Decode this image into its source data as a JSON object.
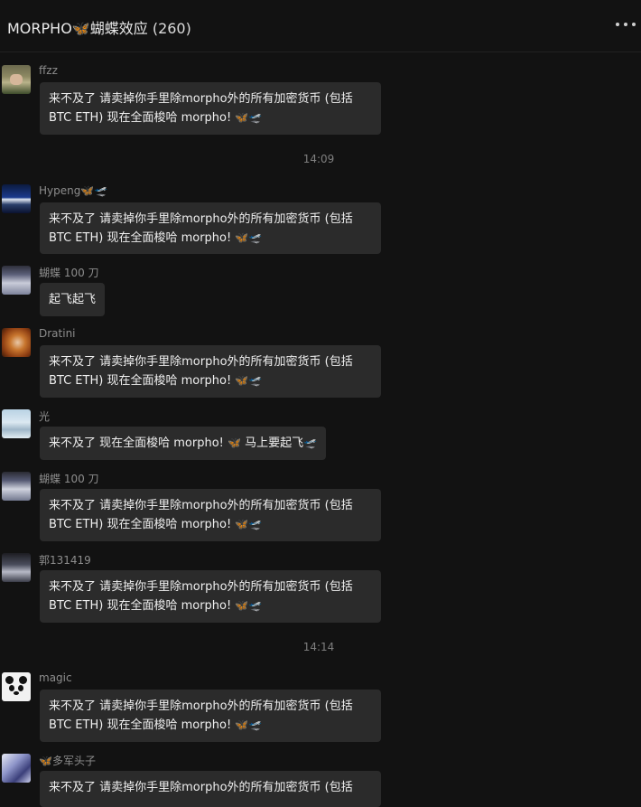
{
  "header": {
    "title_text": "MORPHO",
    "title_icon": "🦋",
    "title_suffix": "蝴蝶效应",
    "member_count": "(260)",
    "more_icon": "more-dots-icon"
  },
  "emoji": {
    "butterfly": "🦋",
    "plane": "🛫"
  },
  "messages": [
    {
      "sender": "ffzz",
      "line1": "来不及了 请卖掉你手里除morpho外的所有加密货币 (包括",
      "line2": "BTC ETH) 现在全面梭哈 morpho!"
    },
    {
      "timestamp": "14:09"
    },
    {
      "sender": "Hypeng",
      "line1": "来不及了 请卖掉你手里除morpho外的所有加密货币 (包括",
      "line2": "BTC ETH) 现在全面梭哈 morpho!"
    },
    {
      "sender": "蝴蝶 100 刀",
      "text": "起飞起飞"
    },
    {
      "sender": "Dratini",
      "line1": "来不及了 请卖掉你手里除morpho外的所有加密货币 (包括",
      "line2": "BTC ETH) 现在全面梭哈 morpho!"
    },
    {
      "sender": "光",
      "text_a": "来不及了 现在全面梭哈 morpho!",
      "text_b": "马上要起飞"
    },
    {
      "sender": "蝴蝶 100 刀",
      "line1": "来不及了 请卖掉你手里除morpho外的所有加密货币 (包括",
      "line2": "BTC ETH) 现在全面梭哈 morpho!"
    },
    {
      "sender": "郭131419",
      "line1": "来不及了 请卖掉你手里除morpho外的所有加密货币 (包括",
      "line2": "BTC ETH) 现在全面梭哈 morpho!"
    },
    {
      "timestamp": "14:14"
    },
    {
      "sender": "magic",
      "line1": "来不及了 请卖掉你手里除morpho外的所有加密货币 (包括",
      "line2": "BTC ETH) 现在全面梭哈 morpho!"
    },
    {
      "sender": "多军头子",
      "line1": "来不及了 请卖掉你手里除morpho外的所有加密货币 (包括"
    }
  ],
  "colors": {
    "background": "#121212",
    "bubble": "#2b2b2b",
    "butterfly": "#3ea4ff"
  }
}
